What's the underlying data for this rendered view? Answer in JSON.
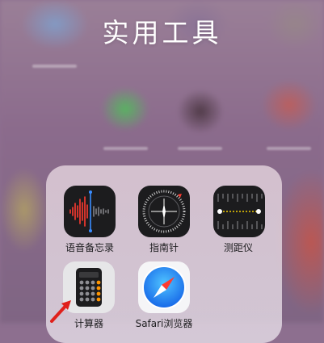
{
  "folder": {
    "title": "实用工具"
  },
  "apps": {
    "voice_memos": {
      "label": "语音备忘录",
      "icon": "voice-memos-icon"
    },
    "compass": {
      "label": "指南针",
      "icon": "compass-icon"
    },
    "measure": {
      "label": "测距仪",
      "icon": "measure-icon"
    },
    "calculator": {
      "label": "计算器",
      "icon": "calculator-icon"
    },
    "safari": {
      "label": "Safari浏览器",
      "icon": "safari-icon"
    }
  },
  "colors": {
    "voice_wave": "#ff3b30",
    "measure_dot": "#f5d000",
    "calc_orange": "#ff9500",
    "arrow": "#e0201b"
  }
}
